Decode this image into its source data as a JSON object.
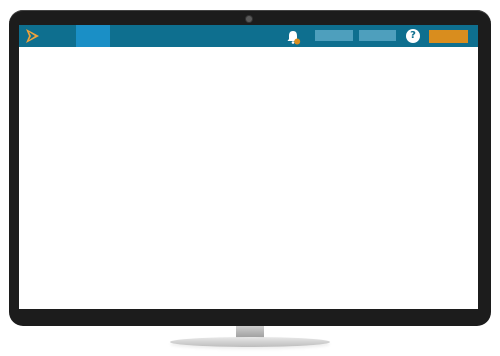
{
  "topbar": {
    "help_label": "?",
    "colors": {
      "bar": "#0e6f8f",
      "active_nav": "#1a8fc6",
      "muted_button": "#4e9fbd",
      "cta": "#d98d1e",
      "logo": "#f0a23a"
    },
    "icons": {
      "logo": "brand-chevron-logo",
      "notification": "bell-icon",
      "help": "help-icon"
    }
  }
}
